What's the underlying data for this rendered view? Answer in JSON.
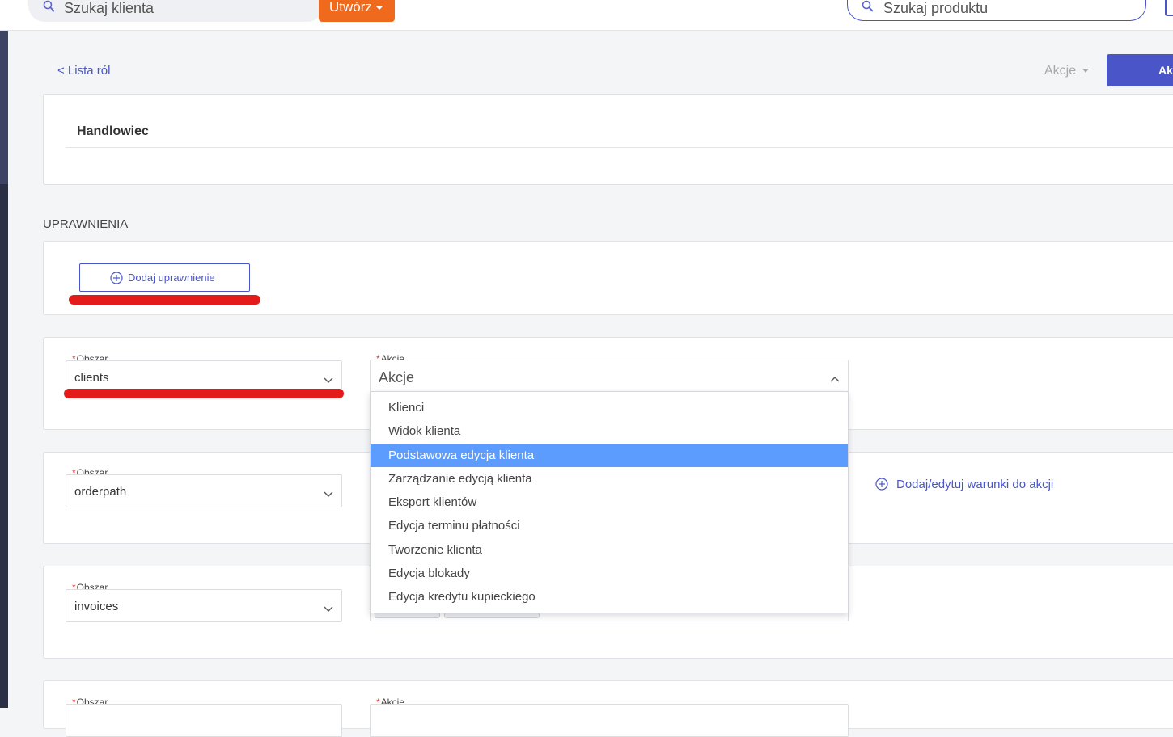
{
  "topbar": {
    "client_search_placeholder": "Szukaj klienta",
    "create_label": "Utwórz",
    "product_search_placeholder": "Szukaj produktu"
  },
  "header": {
    "back_label": "< Lista ról",
    "actions_label": "Akcje",
    "primary_label": "Ak"
  },
  "role": {
    "name": "Handlowiec"
  },
  "permissions": {
    "section_title": "UPRAWNIENIA",
    "add_label": "Dodaj uprawnienie",
    "area_label": "Obszar",
    "actions_label": "Akcje",
    "required_mark": "*",
    "rows": [
      {
        "area": "clients",
        "actions_placeholder": "Akcje"
      },
      {
        "area": "orderpath"
      },
      {
        "area": "invoices"
      },
      {
        "area": ""
      }
    ],
    "conditions_link": "Dodaj/edytuj warunki do akcji"
  },
  "dropdown": {
    "options": [
      "Klienci",
      "Widok klienta",
      "Podstawowa edycja klienta",
      "Zarządzanie edycją klienta",
      "Eksport klientów",
      "Edycja terminu płatności",
      "Tworzenie klienta",
      "Edycja blokady",
      "Edycja kredytu kupieckiego"
    ],
    "highlighted_index": 2
  },
  "colors": {
    "accent": "#4a56c8",
    "create_button": "#f06a1d",
    "highlight": "#5c9cff",
    "annotation": "#e41b1b"
  }
}
